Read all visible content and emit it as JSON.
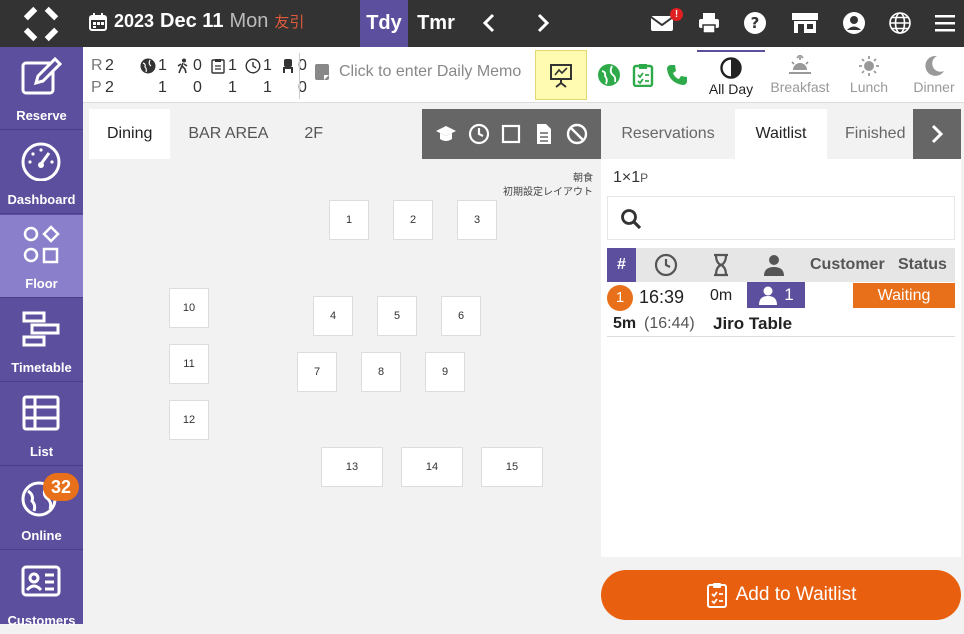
{
  "header": {
    "year": "2023",
    "month_day": "Dec 11",
    "weekday": "Mon",
    "rokuyo": "友引",
    "today_label": "Tdy",
    "tomorrow_label": "Tmr",
    "mail_badge": "!"
  },
  "sidebar": {
    "items": [
      {
        "label": "Reserve",
        "icon": "edit-icon"
      },
      {
        "label": "Dashboard",
        "icon": "gauge-icon"
      },
      {
        "label": "Floor",
        "icon": "shapes-icon"
      },
      {
        "label": "Timetable",
        "icon": "timetable-icon"
      },
      {
        "label": "List",
        "icon": "list-icon"
      },
      {
        "label": "Online",
        "icon": "globe-icon",
        "badge": "32"
      },
      {
        "label": "Customers",
        "icon": "id-card-icon"
      }
    ]
  },
  "stats": {
    "r_label": "R",
    "p_label": "P",
    "r_values": [
      "2",
      "1",
      "0",
      "1",
      "1",
      "0"
    ],
    "p_values": [
      "2",
      "1",
      "0",
      "1",
      "1",
      "0"
    ]
  },
  "memo": {
    "placeholder": "Click to enter Daily Memo"
  },
  "meal_periods": [
    {
      "label": "All Day",
      "active": true
    },
    {
      "label": "Breakfast",
      "active": false
    },
    {
      "label": "Lunch",
      "active": false
    },
    {
      "label": "Dinner",
      "active": false
    }
  ],
  "floor_tabs": [
    "Dining",
    "BAR AREA",
    "2F"
  ],
  "layout_label": {
    "line1": "朝食",
    "line2": "初期設定レイアウト"
  },
  "tables": [
    "1",
    "2",
    "3",
    "4",
    "5",
    "6",
    "7",
    "8",
    "9",
    "10",
    "11",
    "12",
    "13",
    "14",
    "15"
  ],
  "right_tabs": [
    "Reservations",
    "Waitlist",
    "Finished"
  ],
  "waitlist": {
    "party_summary": "1×1",
    "party_unit": "P",
    "columns": {
      "number": "#",
      "customer": "Customer",
      "status": "Status"
    },
    "entries": [
      {
        "number": "1",
        "time": "16:39",
        "wait": "0m",
        "party": "1",
        "status": "Waiting",
        "elapsed": "5m",
        "since": "(16:44)",
        "name": "Jiro Table"
      }
    ]
  },
  "add_button": "Add to Waitlist",
  "colors": {
    "brand": "#5c4f9e",
    "accent": "#e8701a",
    "topbar": "#333333"
  }
}
